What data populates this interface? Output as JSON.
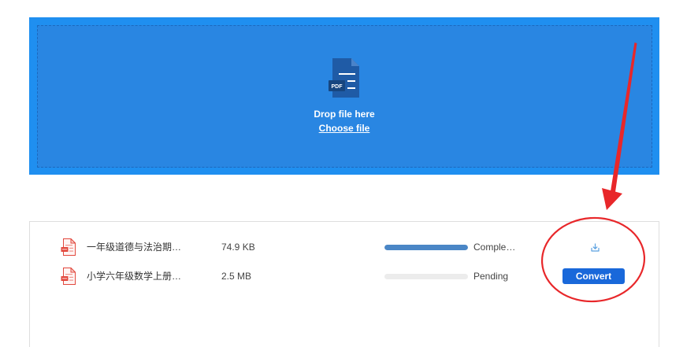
{
  "colors": {
    "dropzone_outer": "#1f8ff0",
    "dropzone_inner": "#2986e2",
    "dropzone_dash": "#1c68bd",
    "file_icon_blue": "#1f5ba6",
    "pdf_red": "#e2483d",
    "progress_fill": "#4a86c6",
    "progress_track": "#ececec",
    "button_blue": "#1968da",
    "download_icon": "#5aa0e0",
    "annotation_red": "#e8272a"
  },
  "dropzone": {
    "icon": "pdf-file-icon",
    "icon_badge": "PDF",
    "title": "Drop file here",
    "choose_link": "Choose file"
  },
  "files": [
    {
      "icon": "pdf-icon",
      "name": "一年级道德与法治期…",
      "size": "74.9 KB",
      "progress": 1,
      "status": "Comple…",
      "action": {
        "icon": "download-icon"
      }
    },
    {
      "icon": "pdf-icon",
      "name": "小学六年级数学上册…",
      "size": "2.5 MB",
      "progress": 0,
      "status": "Pending",
      "action": {
        "label": "Convert"
      }
    }
  ]
}
